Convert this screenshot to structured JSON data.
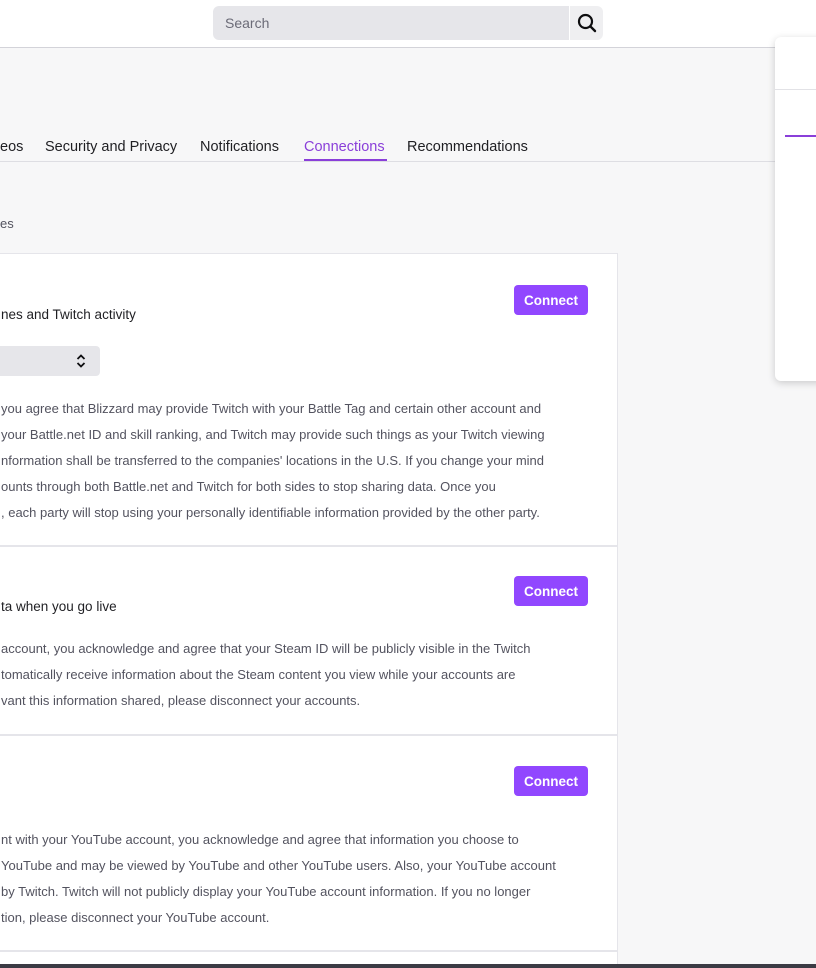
{
  "search": {
    "placeholder": "Search"
  },
  "tabs": [
    {
      "label": "eos"
    },
    {
      "label": "Security and Privacy"
    },
    {
      "label": "Notifications"
    },
    {
      "label": "Connections"
    },
    {
      "label": "Recommendations"
    }
  ],
  "active_tab": "Connections",
  "section_note": "es",
  "connections": [
    {
      "subtitle": "nes and Twitch activity",
      "button": "Connect",
      "description": [
        "you agree that Blizzard may provide Twitch with your Battle Tag and certain other account and",
        " your Battle.net ID and skill ranking, and Twitch may provide such things as your Twitch viewing",
        "nformation shall be transferred to the companies' locations in the U.S. If you change your mind",
        "ounts through both Battle.net and Twitch for both sides to stop sharing data. Once you",
        ", each party will stop using your personally identifiable information provided by the other party."
      ]
    },
    {
      "subtitle": "ta when you go live",
      "button": "Connect",
      "description": [
        " account, you acknowledge and agree that your Steam ID will be publicly visible in the Twitch",
        "tomatically receive information about the Steam content you view while your accounts are",
        "vant this information shared, please disconnect your accounts."
      ]
    },
    {
      "subtitle": "",
      "button": "Connect",
      "description": [
        "nt with your YouTube account, you acknowledge and agree that information you choose to",
        "YouTube and may be viewed by YouTube and other YouTube users. Also, your YouTube account",
        "by Twitch. Twitch will not publicly display your YouTube account information. If you no longer",
        "tion, please disconnect your YouTube account."
      ]
    }
  ],
  "colors": {
    "accent": "#9147ff",
    "tab_active": "#8a3fd9"
  }
}
